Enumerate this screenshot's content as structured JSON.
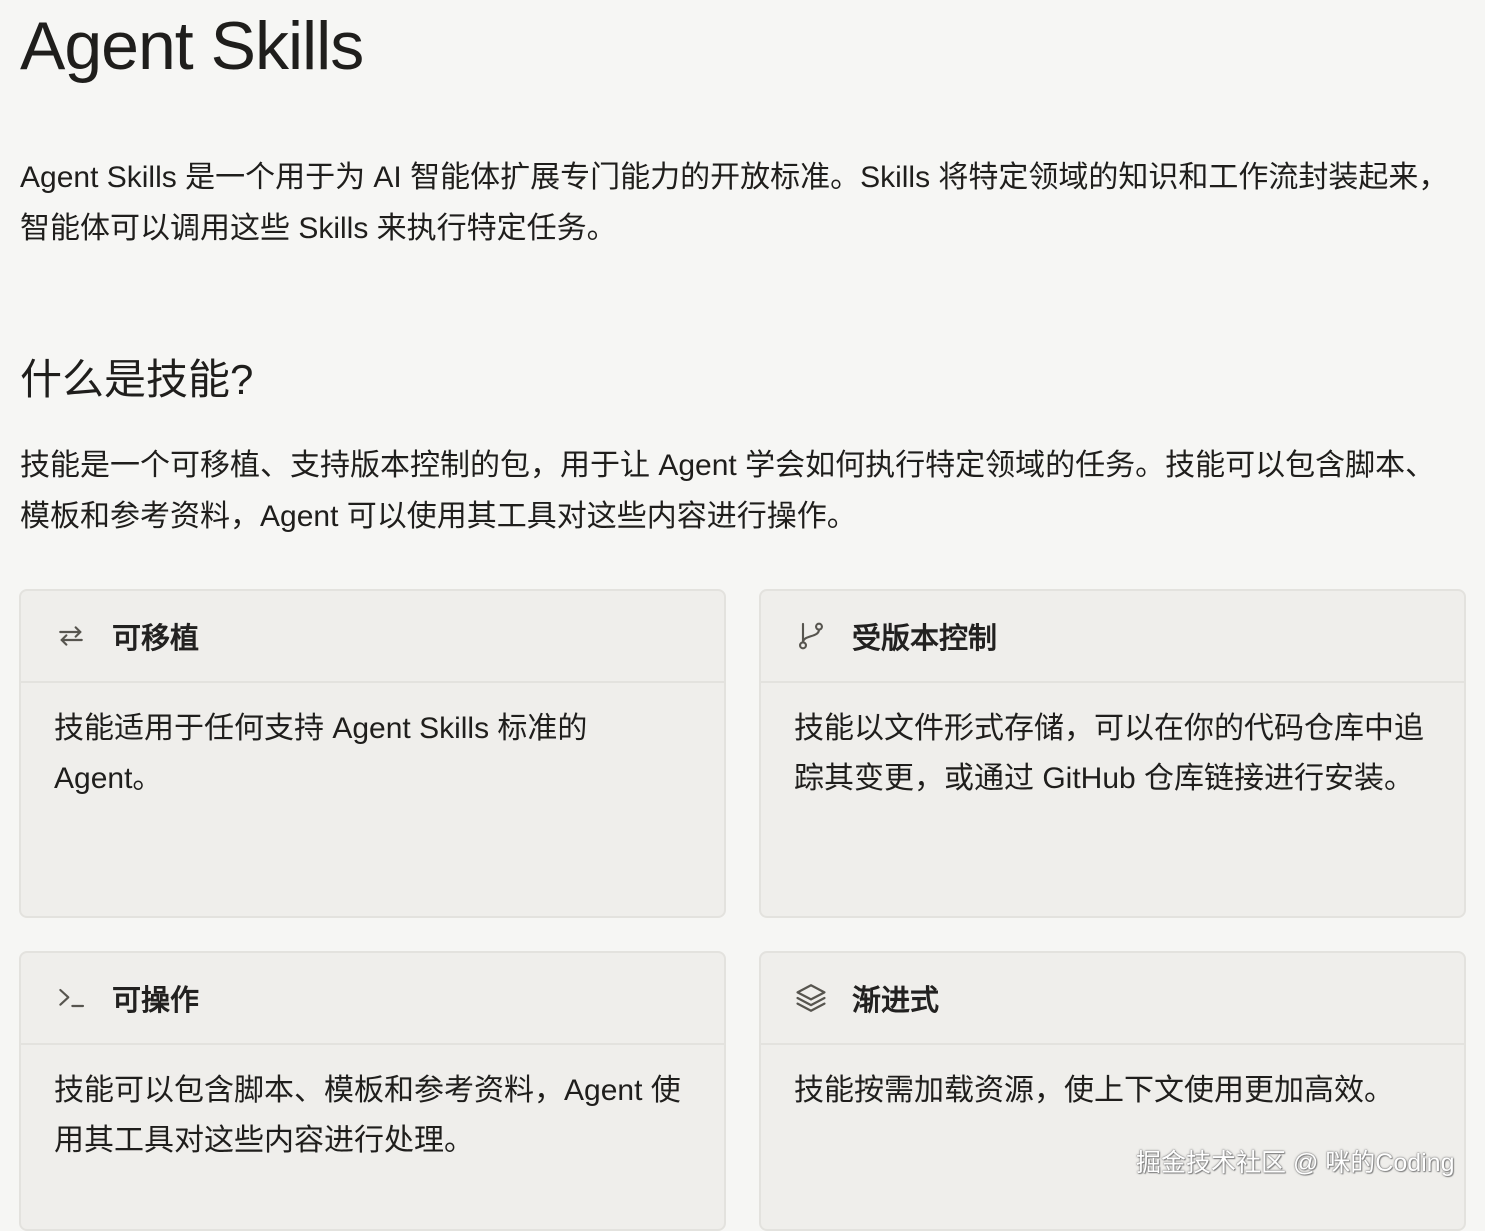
{
  "page": {
    "title": "Agent Skills",
    "intro": "Agent Skills 是一个用于为 AI 智能体扩展专门能力的开放标准。Skills 将特定领域的知识和工作流封装起来，智能体可以调用这些 Skills 来执行特定任务。"
  },
  "section": {
    "heading": "什么是技能?",
    "description": "技能是一个可移植、支持版本控制的包，用于让 Agent 学会如何执行特定领域的任务。技能可以包含脚本、模板和参考资料，Agent 可以使用其工具对这些内容进行操作。"
  },
  "cards": [
    {
      "icon": "arrows-swap-icon",
      "title": "可移植",
      "body": "技能适用于任何支持 Agent Skills 标准的 Agent。"
    },
    {
      "icon": "git-branch-icon",
      "title": "受版本控制",
      "body": "技能以文件形式存储，可以在你的代码仓库中追踪其变更，或通过 GitHub 仓库链接进行安装。"
    },
    {
      "icon": "terminal-icon",
      "title": "可操作",
      "body": "技能可以包含脚本、模板和参考资料，Agent 使用其工具对这些内容进行处理。"
    },
    {
      "icon": "layers-icon",
      "title": "渐进式",
      "body": "技能按需加载资源，使上下文使用更加高效。"
    }
  ],
  "watermark": "掘金技术社区 @ 咪的Coding"
}
